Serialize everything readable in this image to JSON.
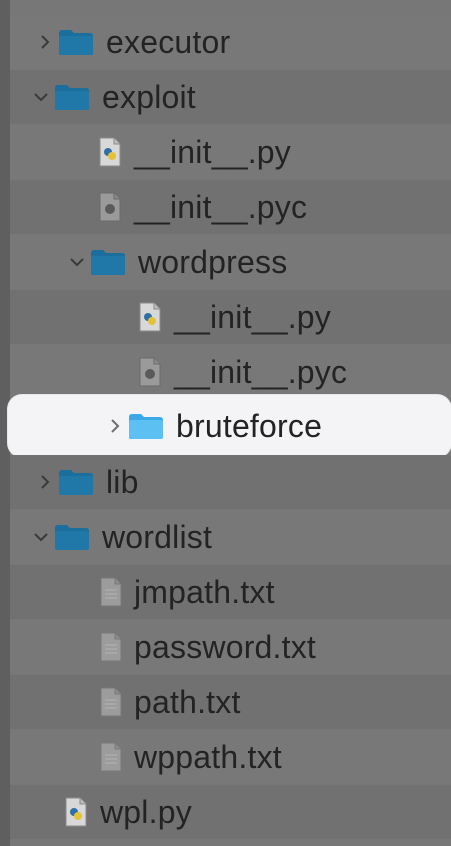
{
  "tree": {
    "rows": [
      {
        "label": "executor",
        "kind": "folder",
        "expanded": false,
        "icon": "folder-icon"
      },
      {
        "label": "exploit",
        "kind": "folder",
        "expanded": true,
        "icon": "folder-icon"
      },
      {
        "label": "__init__.py",
        "kind": "python-file",
        "icon": "python-file-icon"
      },
      {
        "label": "__init__.pyc",
        "kind": "compiled-file",
        "icon": "compiled-python-file-icon"
      },
      {
        "label": "wordpress",
        "kind": "folder",
        "expanded": true,
        "icon": "folder-icon"
      },
      {
        "label": "__init__.py",
        "kind": "python-file",
        "icon": "python-file-icon"
      },
      {
        "label": "__init__.pyc",
        "kind": "compiled-file",
        "icon": "compiled-python-file-icon"
      },
      {
        "label": "bruteforce",
        "kind": "folder",
        "expanded": false,
        "selected": true,
        "icon": "folder-icon"
      },
      {
        "label": "lib",
        "kind": "folder",
        "expanded": false,
        "icon": "folder-icon"
      },
      {
        "label": "wordlist",
        "kind": "folder",
        "expanded": true,
        "icon": "folder-icon"
      },
      {
        "label": "jmpath.txt",
        "kind": "text-file",
        "icon": "text-file-icon"
      },
      {
        "label": "password.txt",
        "kind": "text-file",
        "icon": "text-file-icon"
      },
      {
        "label": "path.txt",
        "kind": "text-file",
        "icon": "text-file-icon"
      },
      {
        "label": "wppath.txt",
        "kind": "text-file",
        "icon": "text-file-icon"
      },
      {
        "label": "wpl.py",
        "kind": "python-file",
        "icon": "python-file-icon"
      }
    ]
  },
  "colors": {
    "folder": "#1c6f9c",
    "folder_selected": "#3aa9e6",
    "selected_bg": "#f4f4f6",
    "text": "#232323"
  }
}
